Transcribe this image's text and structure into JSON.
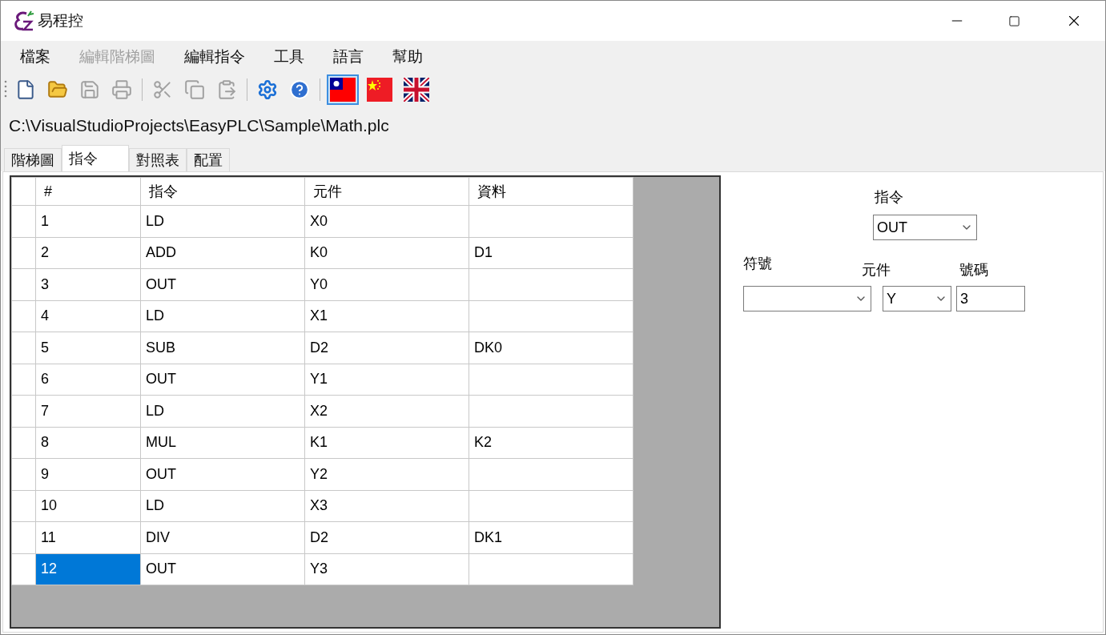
{
  "window": {
    "title": "易程控"
  },
  "menu": [
    {
      "label": "檔案",
      "disabled": false
    },
    {
      "label": "編輯階梯圖",
      "disabled": true
    },
    {
      "label": "編輯指令",
      "disabled": false
    },
    {
      "label": "工具",
      "disabled": false
    },
    {
      "label": "語言",
      "disabled": false
    },
    {
      "label": "幫助",
      "disabled": false
    }
  ],
  "toolbar": [
    [
      {
        "kind": "new",
        "disabled": false
      },
      {
        "kind": "open",
        "disabled": false
      },
      {
        "kind": "save",
        "disabled": true
      },
      {
        "kind": "print",
        "disabled": true
      }
    ],
    [
      {
        "kind": "cut",
        "disabled": true
      },
      {
        "kind": "copy",
        "disabled": true
      },
      {
        "kind": "paste",
        "disabled": true
      }
    ],
    [
      {
        "kind": "settings",
        "disabled": false
      },
      {
        "kind": "help",
        "disabled": false
      }
    ],
    [
      {
        "kind": "flag_tw",
        "selected": true
      },
      {
        "kind": "flag_cn",
        "selected": false
      },
      {
        "kind": "flag_uk",
        "selected": false
      }
    ]
  ],
  "file_path": "C:\\VisualStudioProjects\\EasyPLC\\Sample\\Math.plc",
  "tabs": [
    {
      "label": "階梯圖",
      "selected": false
    },
    {
      "label": "指令",
      "selected": true
    },
    {
      "label": "對照表",
      "selected": false
    },
    {
      "label": "配置",
      "selected": false
    }
  ],
  "table": {
    "columns": [
      "#",
      "指令",
      "元件",
      "資料"
    ],
    "rows": [
      {
        "cells": [
          "1",
          "LD",
          "X0",
          ""
        ],
        "selected": false
      },
      {
        "cells": [
          "2",
          "ADD",
          "K0",
          "D1"
        ],
        "selected": false
      },
      {
        "cells": [
          "3",
          "OUT",
          "Y0",
          ""
        ],
        "selected": false
      },
      {
        "cells": [
          "4",
          "LD",
          "X1",
          ""
        ],
        "selected": false
      },
      {
        "cells": [
          "5",
          "SUB",
          "D2",
          "DK0"
        ],
        "selected": false
      },
      {
        "cells": [
          "6",
          "OUT",
          "Y1",
          ""
        ],
        "selected": false
      },
      {
        "cells": [
          "7",
          "LD",
          "X2",
          ""
        ],
        "selected": false
      },
      {
        "cells": [
          "8",
          "MUL",
          "K1",
          "K2"
        ],
        "selected": false
      },
      {
        "cells": [
          "9",
          "OUT",
          "Y2",
          ""
        ],
        "selected": false
      },
      {
        "cells": [
          "10",
          "LD",
          "X3",
          ""
        ],
        "selected": false
      },
      {
        "cells": [
          "11",
          "DIV",
          "D2",
          "DK1"
        ],
        "selected": false
      },
      {
        "cells": [
          "12",
          "OUT",
          "Y3",
          ""
        ],
        "selected": true
      }
    ]
  },
  "editor": {
    "instruction": {
      "label": "指令",
      "value": "OUT"
    },
    "symbol": {
      "label": "符號"
    },
    "element": {
      "label": "元件",
      "value": "Y"
    },
    "number": {
      "label": "號碼",
      "value": "3"
    }
  }
}
